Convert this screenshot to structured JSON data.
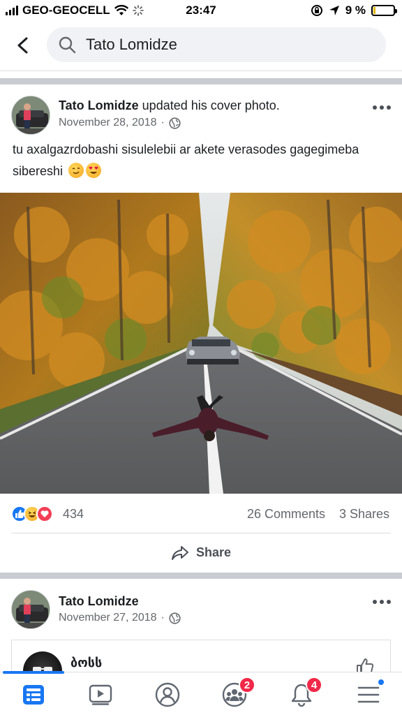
{
  "status_bar": {
    "carrier": "GEO-GEOCELL",
    "time": "23:47",
    "battery": "9 %",
    "battery_level": 0.09
  },
  "search": {
    "query": "Tato Lomidze"
  },
  "post1": {
    "author": "Tato Lomidze",
    "action": " updated his cover photo.",
    "date": "November 28, 2018",
    "separator": "·",
    "privacy_icon": "globe-icon",
    "text": "tu axalgazrdobashi sisulelebii ar akete verasodes gagegimeba sibereshi",
    "emojis": [
      "wink-emoji",
      "heart-eyes-emoji"
    ],
    "reactions": [
      "like",
      "haha",
      "love"
    ],
    "reaction_count": "434",
    "comments": "26 Comments",
    "shares": "3 Shares",
    "share_label": "Share"
  },
  "post2": {
    "author": "Tato Lomidze",
    "date": "November 27, 2018",
    "separator": "·",
    "shared_name": "ბოსს"
  },
  "nav": {
    "items": [
      "feed-icon",
      "watch-icon",
      "profile-icon",
      "groups-icon",
      "notifications-icon",
      "menu-icon"
    ],
    "groups_badge": "2",
    "notifications_badge": "4"
  },
  "colors": {
    "accent": "#1877f2",
    "badge": "#f02849",
    "divider": "#c9ccd1"
  }
}
